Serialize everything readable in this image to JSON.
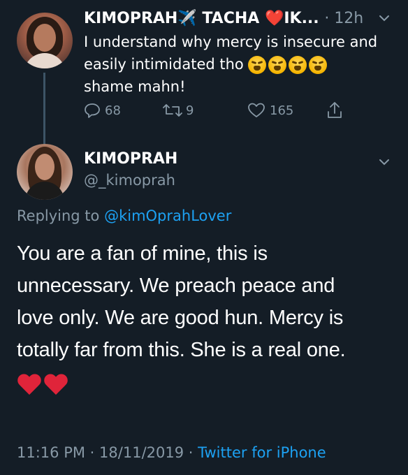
{
  "reply_tweet": {
    "display_name": "KIMOPRAH✈️ TACHA ❤️IK...",
    "timestamp": "· 12h",
    "text_line1": "I understand why mercy is insecure and",
    "text_line2": "easily intimidated tho",
    "text_line3": "shame mahn!",
    "reply_count": "68",
    "retweet_count": "9",
    "like_count": "165"
  },
  "main_tweet": {
    "display_name": "KIMOPRAH",
    "handle": "@_kimoprah",
    "replying_prefix": "Replying to ",
    "replying_to": "@kimOprahLover",
    "body_line1": "You are a fan of mine, this is",
    "body_line2": "unnecessary. We preach peace and",
    "body_line3": "love only. We are good hun. Mercy is",
    "body_line4": "totally far from this. She is a real one.",
    "time": "11:16 PM",
    "date": "18/11/2019",
    "separator": "·",
    "source": "Twitter for iPhone"
  },
  "colors": {
    "background": "#141d26",
    "muted": "#8899a6",
    "link": "#1da1f2",
    "heart": "#e0245e"
  },
  "icons": [
    "reply-icon",
    "retweet-icon",
    "like-icon",
    "share-icon",
    "chevron-down-icon"
  ]
}
